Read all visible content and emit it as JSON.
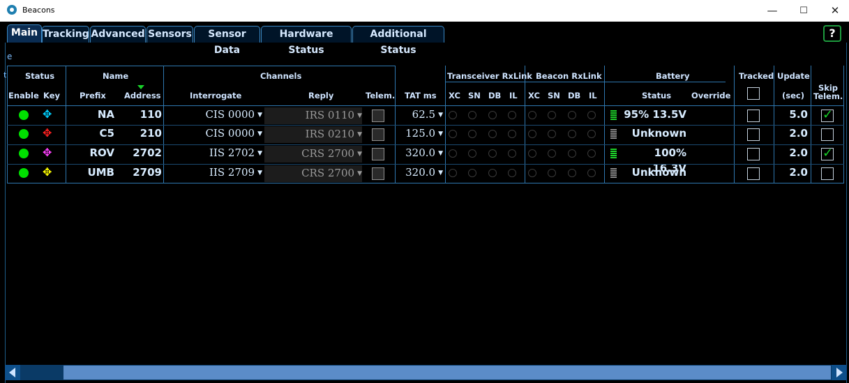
{
  "window": {
    "title": "Beacons",
    "minimize": "—",
    "maximize": "☐",
    "close": "✕"
  },
  "tabs": [
    {
      "label": "Main"
    },
    {
      "label": "Tracking"
    },
    {
      "label": "Advanced"
    },
    {
      "label": "Sensors"
    },
    {
      "label": "Sensor Data"
    },
    {
      "label": "Hardware Status"
    },
    {
      "label": "Additional Status"
    }
  ],
  "help_label": "?",
  "cut_labels": {
    "e": "e",
    "t": "t"
  },
  "headers": {
    "status": "Status",
    "name": "Name",
    "channels": "Channels",
    "tat": "TAT ms",
    "transceiver_rxlink": "Transceiver RxLink",
    "beacon_rxlink": "Beacon RxLink",
    "battery": "Battery",
    "tracked": "Tracked",
    "update": "Update",
    "update_unit": "(sec)",
    "skip_telem": "Skip Telem.",
    "enable": "Enable",
    "key": "Key",
    "prefix": "Prefix",
    "address": "Address",
    "interrogate": "Interrogate",
    "reply": "Reply",
    "telem": "Telem.",
    "xc": "XC",
    "sn": "SN",
    "db": "DB",
    "il": "IL",
    "battery_status": "Status",
    "override": "Override"
  },
  "rows": [
    {
      "key_color": "#00d0ff",
      "prefix": "NA",
      "address": "110",
      "interrogate": "CIS 0000",
      "reply": "IRS 0110",
      "tat": "62.5",
      "battery": "95% 13.5V",
      "battery_level": 1.0,
      "update": "5.0",
      "skip_telem": true
    },
    {
      "key_color": "#ff2020",
      "prefix": "C5",
      "address": "210",
      "interrogate": "CIS 0000",
      "reply": "IRS 0210",
      "tat": "125.0",
      "battery": "Unknown",
      "battery_level": 0,
      "update": "2.0",
      "skip_telem": false
    },
    {
      "key_color": "#ff40ff",
      "prefix": "ROV",
      "address": "2702",
      "interrogate": "IIS 2702",
      "reply": "CRS 2700",
      "tat": "320.0",
      "battery": "100% 16.3V",
      "battery_level": 1.0,
      "update": "2.0",
      "skip_telem": true
    },
    {
      "key_color": "#ffff00",
      "prefix": "UMB",
      "address": "2709",
      "interrogate": "IIS 2709",
      "reply": "CRS 2700",
      "tat": "320.0",
      "battery": "Unknown",
      "battery_level": 0,
      "update": "2.0",
      "skip_telem": false
    }
  ],
  "colors": {
    "accent": "#2f78b0",
    "led_on": "#00e000",
    "check": "#19d12a",
    "sort_indicator": "#19d12a"
  }
}
